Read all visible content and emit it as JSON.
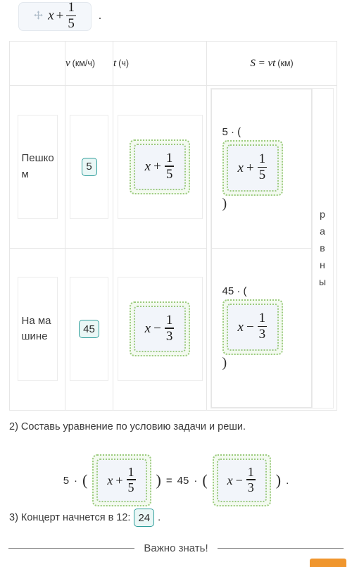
{
  "drag_chip": {
    "icon": "move-arrows-icon",
    "expression": {
      "var": "x",
      "op": "+",
      "numerator": "1",
      "denominator": "5"
    },
    "trailing_punctuation": "."
  },
  "table": {
    "headers": [
      {
        "text": "",
        "name": "header-blank"
      },
      {
        "symbol": "v",
        "unit": "(км/ч)",
        "name": "header-speed"
      },
      {
        "symbol": "t",
        "unit": "(ч)",
        "name": "header-time"
      },
      {
        "symbol": "S = vt",
        "unit": "(км)",
        "name": "header-distance"
      }
    ],
    "rows": [
      {
        "mode": "Пешком",
        "speed": "5",
        "time": {
          "var": "x",
          "op": "+",
          "numerator": "1",
          "denominator": "5"
        },
        "distance_prefix": "5 · (",
        "distance_expr": {
          "var": "x",
          "op": "+",
          "numerator": "1",
          "denominator": "5"
        },
        "distance_suffix": ")"
      },
      {
        "mode": "На машине",
        "speed": "45",
        "time": {
          "var": "x",
          "op": "−",
          "numerator": "1",
          "denominator": "3"
        },
        "distance_prefix": "45 · (",
        "distance_expr": {
          "var": "x",
          "op": "−",
          "numerator": "1",
          "denominator": "3"
        },
        "distance_suffix": ")"
      }
    ],
    "equal_column_label": "равны",
    "equal_column_letters": [
      "р",
      "а",
      "в",
      "н",
      "ы"
    ]
  },
  "question2": {
    "text": "2) Составь уравнение по условию задачи и реши.",
    "equation": {
      "left_factor": "5",
      "dot": "·",
      "open_paren": "(",
      "left_expr": {
        "var": "x",
        "op": "+",
        "numerator": "1",
        "denominator": "5"
      },
      "close_paren": ")",
      "equals": "=",
      "right_factor": "45",
      "right_expr": {
        "var": "x",
        "op": "−",
        "numerator": "1",
        "denominator": "3"
      },
      "period": "."
    }
  },
  "question3": {
    "prefix": "3) Концерт начнется в 12:",
    "answer": "24",
    "suffix": "."
  },
  "footer": {
    "label": "Важно знать!"
  },
  "colors": {
    "teal_border": "#2f9e9b",
    "teal_fill": "#eaf7f6",
    "drop_border": "#9ccb7e",
    "drop_fill": "#f3faef",
    "expr_fill": "#f2f5fa",
    "orange": "#f0962e",
    "table_border": "#e6e6e6"
  }
}
